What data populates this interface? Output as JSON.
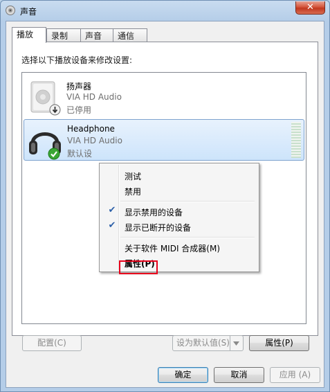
{
  "window": {
    "title": "声音",
    "close_label": "✕"
  },
  "tabs": [
    {
      "label": "播放",
      "active": true
    },
    {
      "label": "录制",
      "active": false
    },
    {
      "label": "声音",
      "active": false
    },
    {
      "label": "通信",
      "active": false
    }
  ],
  "instruction": "选择以下播放设备来修改设置:",
  "devices": [
    {
      "name": "扬声器",
      "driver": "VIA HD Audio",
      "status": "已停用",
      "icon": "speaker-icon",
      "badge": "disabled-arrow-icon"
    },
    {
      "name": "Headphone",
      "driver": "VIA HD Audio",
      "status": "默认设",
      "icon": "headphone-icon",
      "badge": "default-check-icon"
    }
  ],
  "context_menu": {
    "items": [
      {
        "label": "测试",
        "checked": false
      },
      {
        "label": "禁用",
        "checked": false
      },
      {
        "label": "显示禁用的设备",
        "checked": true
      },
      {
        "label": "显示已断开的设备",
        "checked": true
      },
      {
        "label": "关于软件 MIDI 合成器(M)",
        "checked": false
      },
      {
        "label": "属性(P)",
        "checked": false,
        "bold": true,
        "highlighted": true
      }
    ],
    "check_glyph": "✔"
  },
  "panel_buttons": {
    "configure": "配置(C)",
    "set_default": "设为默认值(S)",
    "properties": "属性(P)"
  },
  "dialog_buttons": {
    "ok": "确定",
    "cancel": "取消",
    "apply": "应用 (A)"
  },
  "colors": {
    "highlight_box": "#e8001c",
    "selection": "#cde4fb",
    "check": "#2b5fa8"
  }
}
